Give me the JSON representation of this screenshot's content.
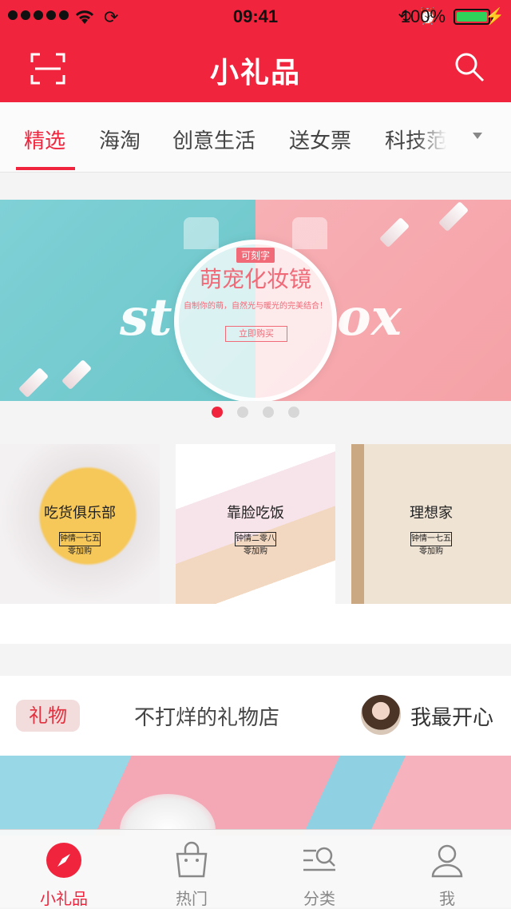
{
  "status_bar": {
    "time": "09:41",
    "battery": "100%"
  },
  "header": {
    "title": "小礼品"
  },
  "tabs": [
    {
      "label": "精选",
      "active": true
    },
    {
      "label": "海淘",
      "active": false
    },
    {
      "label": "创意生活",
      "active": false
    },
    {
      "label": "送女票",
      "active": false
    },
    {
      "label": "科技范",
      "active": false
    }
  ],
  "banner": {
    "tag": "可刻字",
    "title": "萌宠化妆镜",
    "subtitle": "自制你的萌，自然光与暖光的完美结合！",
    "button": "立即购买",
    "page_count": 4,
    "active_page": 1
  },
  "categories": [
    {
      "label": "吃货俱乐部",
      "button": "钟情一七五零加购"
    },
    {
      "label": "靠脸吃饭",
      "button": "钟情二零八零加购"
    },
    {
      "label": "理想家",
      "button": "钟情一七五零加购"
    }
  ],
  "shop": {
    "badge": "礼物",
    "name": "不打烊的礼物店",
    "user": "我最开心"
  },
  "tab_bar": [
    {
      "label": "小礼品",
      "icon": "compass-icon",
      "active": true
    },
    {
      "label": "热门",
      "icon": "shopping-bag-icon",
      "active": false
    },
    {
      "label": "分类",
      "icon": "category-search-icon",
      "active": false
    },
    {
      "label": "我",
      "icon": "person-icon",
      "active": false
    }
  ],
  "colors": {
    "brand": "#f0253d"
  }
}
